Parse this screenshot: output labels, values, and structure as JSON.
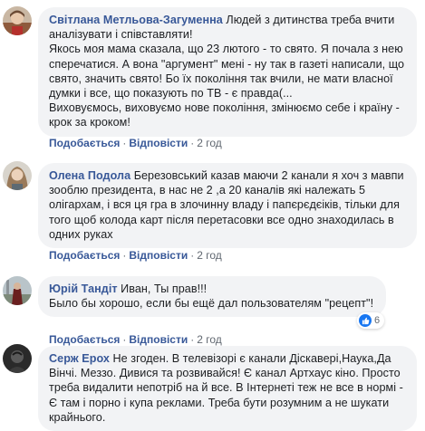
{
  "comments": [
    {
      "author": "Світлана Метльова-Загуменна",
      "lines": [
        " Людей з дитинства треба вчити",
        "аналізувати і співставляти!",
        "Якось моя мама сказала, що 23 лютого - то свято. Я почала з нею",
        "сперечатися. А вона \"аргумент\" мені - ну так в газеті написали, що",
        "свято, значить свято! Бо їх покоління так вчили, не мати власної",
        "думки і все, що показують по ТВ - є правда(...",
        "Виховуємось, виховуємо нове покоління, змінюємо себе і країну -",
        "крок за кроком!"
      ],
      "like": "Подобається",
      "reply": "Відповісти",
      "time": "2 год"
    },
    {
      "author": "Олена Подола",
      "lines": [
        " Березовський казав маючи 2 канали я хоч з мавпи",
        "зооблю президента, в нас не 2 ,а 20 каналів які належать 5",
        "олігархам, і вся ця гра в злочинну владу і папєрєдєіків, тільки для",
        "того щоб колода карт після перетасовки все одно знаходилась в",
        "одних руках"
      ],
      "like": "Подобається",
      "reply": "Відповісти",
      "time": "2 год"
    },
    {
      "author": "Юрій Тандіт",
      "lines": [
        " Иван, Ты прав!!!",
        "Было бы хорошо, если бы ещё дал пользователям \"рецепт\"!"
      ],
      "reaction_count": "6",
      "like": "Подобається",
      "reply": "Відповісти",
      "time": "2 год"
    },
    {
      "author": "Серж Ерох",
      "lines": [
        " Не згоден. В телевізорі є канали Діскавері,Наука,Да",
        "Вінчі. Меззо. Дивися та розвивайся! Є канал Артхаус кіно. Просто",
        "треба видалити непотріб на й все. В Інтернеті теж не все в нормі -",
        "Є там і порно і купа реклами. Треба бути розумним а не шукати",
        "крайнього."
      ]
    }
  ],
  "separator": "·",
  "colors": {
    "bubble": "#f2f3f5",
    "author": "#385898",
    "meta": "#606770",
    "like_badge": "#1877f2"
  },
  "icons": [
    "avatar",
    "like-reaction-icon"
  ]
}
